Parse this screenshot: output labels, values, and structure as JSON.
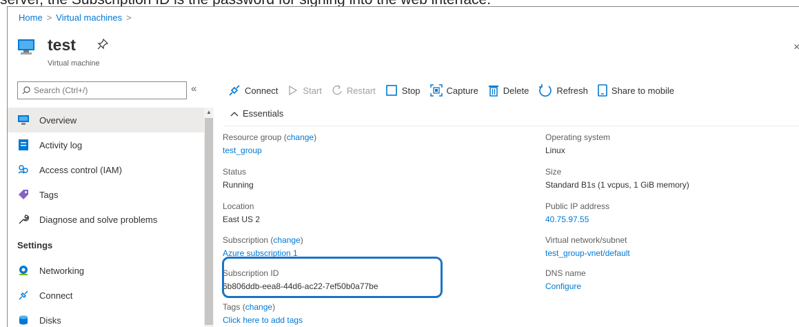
{
  "caption": "server, the Subscription ID is the password for signing into the web interface.",
  "breadcrumb": {
    "home": "Home",
    "sep": ">",
    "vms": "Virtual machines",
    "sep2": ">"
  },
  "header": {
    "title": "test",
    "subtitle": "Virtual machine",
    "close": "×"
  },
  "search": {
    "placeholder": "Search (Ctrl+/)",
    "collapse": "«"
  },
  "sidebar": {
    "items": [
      {
        "label": "Overview"
      },
      {
        "label": "Activity log"
      },
      {
        "label": "Access control (IAM)"
      },
      {
        "label": "Tags"
      },
      {
        "label": "Diagnose and solve problems"
      }
    ],
    "section": "Settings",
    "settings_items": [
      {
        "label": "Networking"
      },
      {
        "label": "Connect"
      },
      {
        "label": "Disks"
      }
    ]
  },
  "toolbar": {
    "connect": "Connect",
    "start": "Start",
    "restart": "Restart",
    "stop": "Stop",
    "capture": "Capture",
    "delete": "Delete",
    "refresh": "Refresh",
    "share": "Share to mobile"
  },
  "essentials": {
    "title": "Essentials",
    "chevron": "^",
    "left": {
      "resource_group": {
        "label": "Resource group",
        "change": "change",
        "value": "test_group"
      },
      "status": {
        "label": "Status",
        "value": "Running"
      },
      "location": {
        "label": "Location",
        "value": "East US 2"
      },
      "subscription": {
        "label": "Subscription",
        "change": "change",
        "value": "Azure subscription 1"
      },
      "subscription_id": {
        "label": "Subscription ID",
        "value": "6b806ddb-eea8-44d6-ac22-7ef50b0a77be"
      },
      "tags": {
        "label": "Tags",
        "change": "change",
        "value": "Click here to add tags"
      }
    },
    "right": {
      "os": {
        "label": "Operating system",
        "value": "Linux"
      },
      "size": {
        "label": "Size",
        "value": "Standard B1s (1 vcpus, 1 GiB memory)"
      },
      "public_ip": {
        "label": "Public IP address",
        "value": "40.75.97.55"
      },
      "vnet": {
        "label": "Virtual network/subnet",
        "value": "test_group-vnet/default"
      },
      "dns": {
        "label": "DNS name",
        "value": "Configure"
      }
    }
  },
  "colors": {
    "accent": "#0078d4",
    "highlight": "#1a73c7",
    "active_bg": "#edebe9"
  }
}
